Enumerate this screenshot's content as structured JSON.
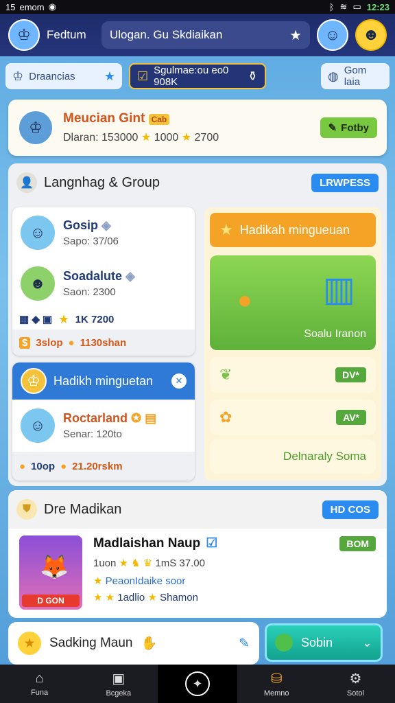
{
  "status": {
    "time_left": "15 ",
    "carrier": "emom",
    "time": "12:23"
  },
  "appbar": {
    "brand": "Fedtum",
    "search_text": "Ulogan. Gu Skdiaikan"
  },
  "tabs": [
    {
      "label": "Draancias"
    },
    {
      "label": "Sgulmae:ou eo0 908K"
    },
    {
      "label": "Gom laia"
    }
  ],
  "top_card": {
    "name": "Meucian Gint",
    "badge": "Cab",
    "stats_label": "Dlaran:",
    "stat1": "153000",
    "stat2": "1000",
    "stat3": "2700",
    "button": "Fotby"
  },
  "group": {
    "title": "Langnhag & Group",
    "button": "LRWPESS",
    "items": [
      {
        "name": "Gosip",
        "sub": "Sapo: 37/06"
      },
      {
        "name": "Soadalute",
        "sub": "Saon: 2300"
      }
    ],
    "row_stats": "1K 7200",
    "footer_left": "3slop",
    "footer_right": "1130shan",
    "highlight_title": "Hadikh minguetan",
    "highlight_item": {
      "name": "Roctarland",
      "sub": "Senar: 120to"
    },
    "highlight_footer_left": "10op",
    "highlight_footer_right": "21.20rskm"
  },
  "right_col": {
    "orange_label": "Hadikah mingueuan",
    "green_label": "Soalu Iranon",
    "tag1": "DV*",
    "tag2": "AV*",
    "bottom_label": "Delnaraly Soma"
  },
  "section2": {
    "title": "Dre Madikan",
    "button": "HD COS",
    "game_badge": "D GON",
    "game_title": "Madlaishan Naup",
    "game_tag": "BOM",
    "line1": "1uon",
    "line1b": "1mS 37.00",
    "line2": "PeaonIdaike soor",
    "line3a": "1adlio",
    "line3b": "Shamon"
  },
  "section3": {
    "label": "Sadking Maun"
  },
  "solbtn": {
    "label": "Sobin"
  },
  "nav": [
    {
      "label": "Funa"
    },
    {
      "label": "Bcgeka"
    },
    {
      "label": ""
    },
    {
      "label": "Memno"
    },
    {
      "label": "Sotol"
    }
  ],
  "colors": {
    "appbar": "#1e2c6b",
    "accent_orange": "#f5a327",
    "accent_green": "#78c840",
    "accent_blue": "#2a8cf0"
  }
}
